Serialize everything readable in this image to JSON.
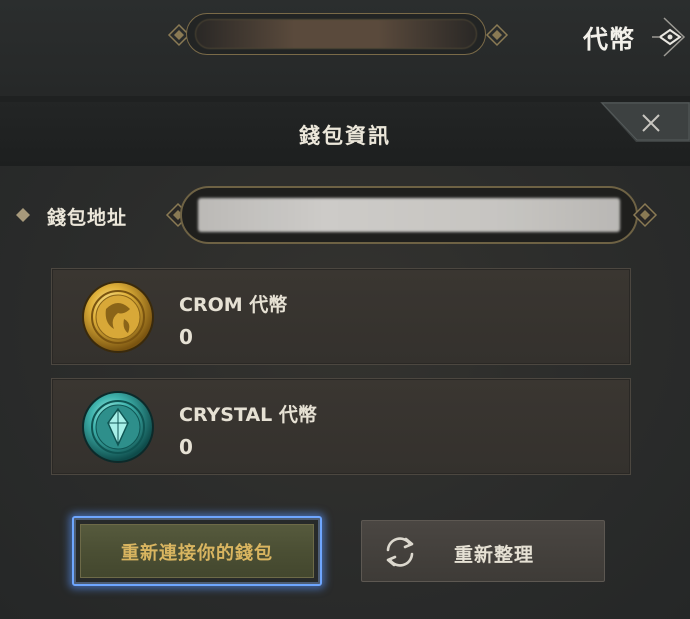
{
  "top_bar": {
    "token_label": "代幣"
  },
  "dialog": {
    "title": "錢包資訊",
    "wallet_address": {
      "label": "錢包地址"
    },
    "tokens": [
      {
        "name": "CROM 代幣",
        "amount": "0",
        "icon": "crom-coin-icon"
      },
      {
        "name": "CRYSTAL 代幣",
        "amount": "0",
        "icon": "crystal-coin-icon"
      }
    ],
    "buttons": {
      "reconnect": "重新連接你的錢包",
      "refresh": "重新整理"
    }
  },
  "colors": {
    "accent_gold": "#d9b560",
    "focus_blue": "#6ea6ff",
    "frame_gold": "#7a6a48"
  }
}
